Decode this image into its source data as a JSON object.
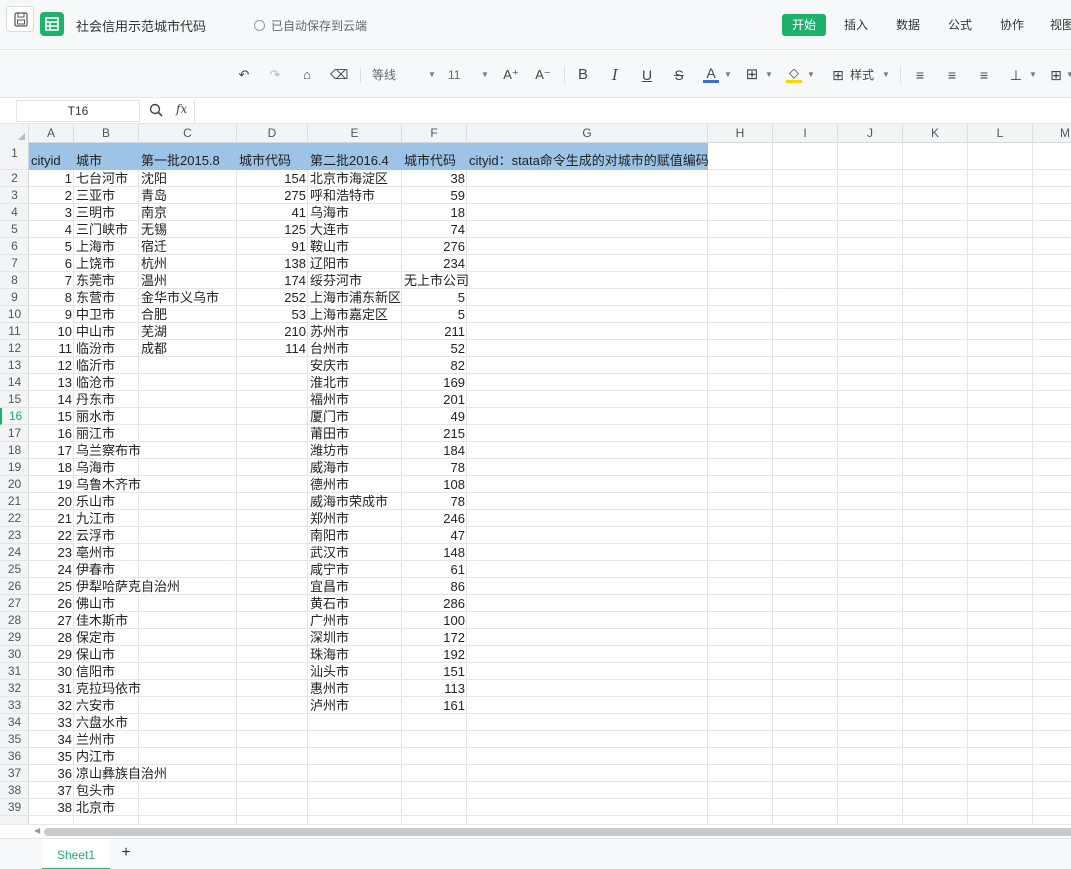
{
  "app": {
    "doc_title": "社会信用示范城市代码",
    "autosave": "已自动保存到云端",
    "accent": "#1fb06b",
    "tabs": [
      "开始",
      "插入",
      "数据",
      "公式",
      "协作",
      "视图"
    ],
    "active_tab": "开始"
  },
  "toolbar": {
    "font_name": "等线",
    "font_size": "11",
    "style_label": "样式",
    "icons": [
      "undo-icon",
      "redo-icon",
      "format-painter-icon",
      "clear-format-icon",
      "increase-font-icon",
      "decrease-font-icon",
      "bold-icon",
      "italic-icon",
      "underline-icon",
      "strikethrough-icon",
      "font-color-icon",
      "borders-icon",
      "fill-color-icon",
      "cell-style-icon",
      "align-left-icon",
      "align-center-icon",
      "align-right-icon",
      "valign-bottom-icon",
      "merge-icon"
    ]
  },
  "formula_bar": {
    "cell_ref": "T16",
    "fx": "fx",
    "value": ""
  },
  "sheet": {
    "columns": [
      "A",
      "B",
      "C",
      "D",
      "E",
      "F",
      "G",
      "H",
      "I",
      "J",
      "K",
      "L",
      "M"
    ],
    "row_numbers": [
      "1",
      "2",
      "3",
      "4",
      "5",
      "6",
      "7",
      "8",
      "9",
      "10",
      "11",
      "12",
      "13",
      "14",
      "15",
      "16",
      "17",
      "18",
      "19",
      "20",
      "21",
      "22",
      "23",
      "24",
      "25",
      "26",
      "27",
      "28",
      "29",
      "30",
      "31",
      "32",
      "33",
      "34",
      "35",
      "36",
      "37",
      "38",
      "39"
    ],
    "selected_row": "16",
    "header_fill": "#9dc3e6",
    "rows": [
      [
        "cityid",
        "城市",
        "第一批2015.8",
        "城市代码",
        "第二批2016.4",
        "城市代码",
        "cityid：stata命令生成的对城市的赋值编码"
      ],
      [
        "1",
        "七台河市",
        "沈阳",
        "154",
        "北京市海淀区",
        "38",
        ""
      ],
      [
        "2",
        "三亚市",
        "青岛",
        "275",
        "呼和浩特市",
        "59",
        ""
      ],
      [
        "3",
        "三明市",
        "南京",
        "41",
        "乌海市",
        "18",
        ""
      ],
      [
        "4",
        "三门峡市",
        "无锡",
        "125",
        "大连市",
        "74",
        ""
      ],
      [
        "5",
        "上海市",
        "宿迁",
        "91",
        "鞍山市",
        "276",
        ""
      ],
      [
        "6",
        "上饶市",
        "杭州",
        "138",
        "辽阳市",
        "234",
        ""
      ],
      [
        "7",
        "东莞市",
        "温州",
        "174",
        "绥芬河市",
        "无上市公司",
        ""
      ],
      [
        "8",
        "东营市",
        "金华市义乌市",
        "252",
        "上海市浦东新区",
        "5",
        ""
      ],
      [
        "9",
        "中卫市",
        "合肥",
        "53",
        "上海市嘉定区",
        "5",
        ""
      ],
      [
        "10",
        "中山市",
        "芜湖",
        "210",
        "苏州市",
        "211",
        ""
      ],
      [
        "11",
        "临汾市",
        "成都",
        "114",
        "台州市",
        "52",
        ""
      ],
      [
        "12",
        "临沂市",
        "",
        "",
        "安庆市",
        "82",
        ""
      ],
      [
        "13",
        "临沧市",
        "",
        "",
        "淮北市",
        "169",
        ""
      ],
      [
        "14",
        "丹东市",
        "",
        "",
        "福州市",
        "201",
        ""
      ],
      [
        "15",
        "丽水市",
        "",
        "",
        "厦门市",
        "49",
        ""
      ],
      [
        "16",
        "丽江市",
        "",
        "",
        "莆田市",
        "215",
        ""
      ],
      [
        "17",
        "乌兰察布市",
        "",
        "",
        "潍坊市",
        "184",
        ""
      ],
      [
        "18",
        "乌海市",
        "",
        "",
        "威海市",
        "78",
        ""
      ],
      [
        "19",
        "乌鲁木齐市",
        "",
        "",
        "德州市",
        "108",
        ""
      ],
      [
        "20",
        "乐山市",
        "",
        "",
        "威海市荣成市",
        "78",
        ""
      ],
      [
        "21",
        "九江市",
        "",
        "",
        "郑州市",
        "246",
        ""
      ],
      [
        "22",
        "云浮市",
        "",
        "",
        "南阳市",
        "47",
        ""
      ],
      [
        "23",
        "亳州市",
        "",
        "",
        "武汉市",
        "148",
        ""
      ],
      [
        "24",
        "伊春市",
        "",
        "",
        "咸宁市",
        "61",
        ""
      ],
      [
        "25",
        "伊犁哈萨克自治州",
        "",
        "",
        "宜昌市",
        "86",
        ""
      ],
      [
        "26",
        "佛山市",
        "",
        "",
        "黄石市",
        "286",
        ""
      ],
      [
        "27",
        "佳木斯市",
        "",
        "",
        "广州市",
        "100",
        ""
      ],
      [
        "28",
        "保定市",
        "",
        "",
        "深圳市",
        "172",
        ""
      ],
      [
        "29",
        "保山市",
        "",
        "",
        "珠海市",
        "192",
        ""
      ],
      [
        "30",
        "信阳市",
        "",
        "",
        "汕头市",
        "151",
        ""
      ],
      [
        "31",
        "克拉玛依市",
        "",
        "",
        "惠州市",
        "113",
        ""
      ],
      [
        "32",
        "六安市",
        "",
        "",
        "泸州市",
        "161",
        ""
      ],
      [
        "33",
        "六盘水市",
        "",
        "",
        "",
        "",
        ""
      ],
      [
        "34",
        "兰州市",
        "",
        "",
        "",
        "",
        ""
      ],
      [
        "35",
        "内江市",
        "",
        "",
        "",
        "",
        ""
      ],
      [
        "36",
        "凉山彝族自治州",
        "",
        "",
        "",
        "",
        ""
      ],
      [
        "37",
        "包头市",
        "",
        "",
        "",
        "",
        ""
      ],
      [
        "38",
        "北京市",
        "",
        "",
        "",
        "",
        ""
      ]
    ]
  },
  "sheet_tabs": {
    "active": "Sheet1",
    "add": "+"
  }
}
